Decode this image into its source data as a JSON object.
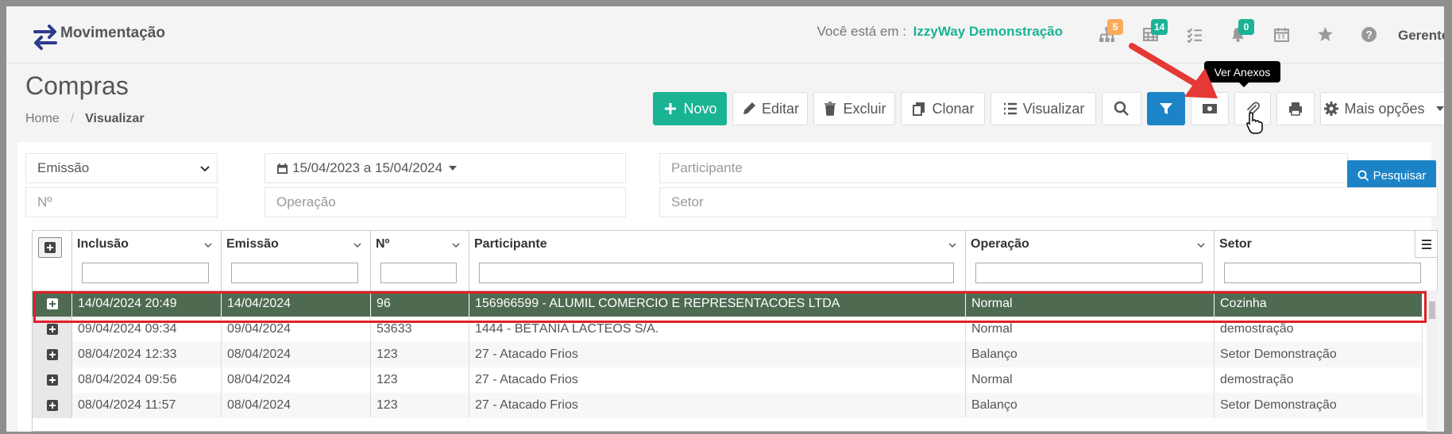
{
  "header": {
    "app_title": "Movimentação",
    "location_label": "Você está em :",
    "location_value": "IzzyWay Demonstração",
    "user": "Gerente",
    "badges": {
      "org": "5",
      "grid": "14",
      "notifications": "0"
    }
  },
  "page": {
    "title": "Compras",
    "breadcrumb": {
      "home": "Home",
      "separator": "/",
      "current": "Visualizar"
    }
  },
  "toolbar": {
    "new_label": "Novo",
    "edit_label": "Editar",
    "delete_label": "Excluir",
    "clone_label": "Clonar",
    "view_label": "Visualizar",
    "more_label": "Mais opções",
    "tooltip": "Ver Anexos"
  },
  "filters": {
    "date_type": "Emissão",
    "date_range": "15/04/2023 a 15/04/2024",
    "participant_placeholder": "Participante",
    "number_placeholder": "Nº",
    "operation_placeholder": "Operação",
    "sector_placeholder": "Setor",
    "search_label": "Pesquisar"
  },
  "grid": {
    "columns": [
      "Inclusão",
      "Emissão",
      "Nº",
      "Participante",
      "Operação",
      "Setor"
    ],
    "rows": [
      [
        "14/04/2024 20:49",
        "14/04/2024",
        "96",
        "156966599 - ALUMIL COMERCIO E REPRESENTACOES LTDA",
        "Normal",
        "Cozinha"
      ],
      [
        "09/04/2024 09:34",
        "09/04/2024",
        "53633",
        "1444 - BETÂNIA LÁCTEOS S/A.",
        "Normal",
        "demostração"
      ],
      [
        "08/04/2024 12:33",
        "08/04/2024",
        "123",
        "27 - Atacado Frios",
        "Balanço",
        "Setor Demonstração"
      ],
      [
        "08/04/2024 09:56",
        "08/04/2024",
        "123",
        "27 - Atacado Frios",
        "Normal",
        "demostração"
      ],
      [
        "08/04/2024 11:57",
        "08/04/2024",
        "123",
        "27 - Atacado Frios",
        "Balanço",
        "Setor Demonstração"
      ]
    ],
    "selected_row": 0
  },
  "colors": {
    "brand_green": "#1ab394",
    "filter_blue": "#1c84c6",
    "selected_row": "#4e6b52",
    "highlight_red": "#e0202a"
  }
}
